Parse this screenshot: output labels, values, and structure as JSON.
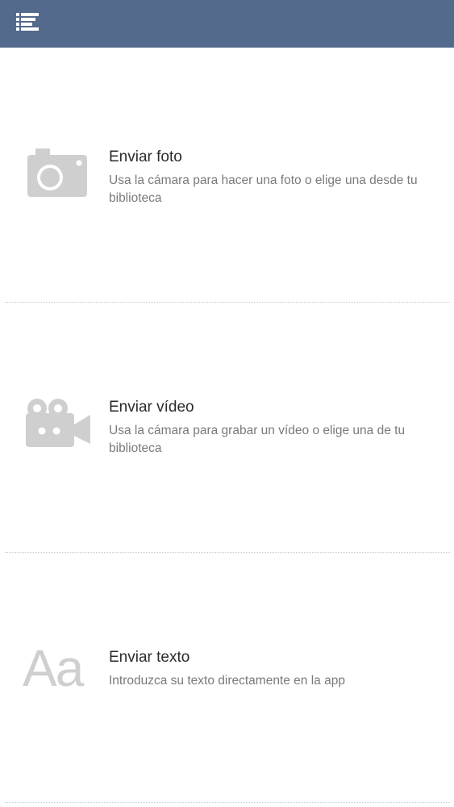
{
  "colors": {
    "topbar": "#536a8c",
    "icon_gray": "#cfcfcf",
    "title_text": "#2b2b2b",
    "desc_text": "#7a7a7a"
  },
  "header": {
    "menu_icon": "list-menu-icon"
  },
  "options": [
    {
      "icon": "camera-icon",
      "title": "Enviar foto",
      "description": "Usa la cámara para hacer una foto o elige una desde tu biblioteca"
    },
    {
      "icon": "video-camera-icon",
      "title": "Enviar vídeo",
      "description": "Usa la cámara para grabar un vídeo o elige una de tu biblioteca"
    },
    {
      "icon": "text-icon",
      "icon_text": "Aa",
      "title": "Enviar texto",
      "description": "Introduzca su texto directamente en la app"
    }
  ]
}
